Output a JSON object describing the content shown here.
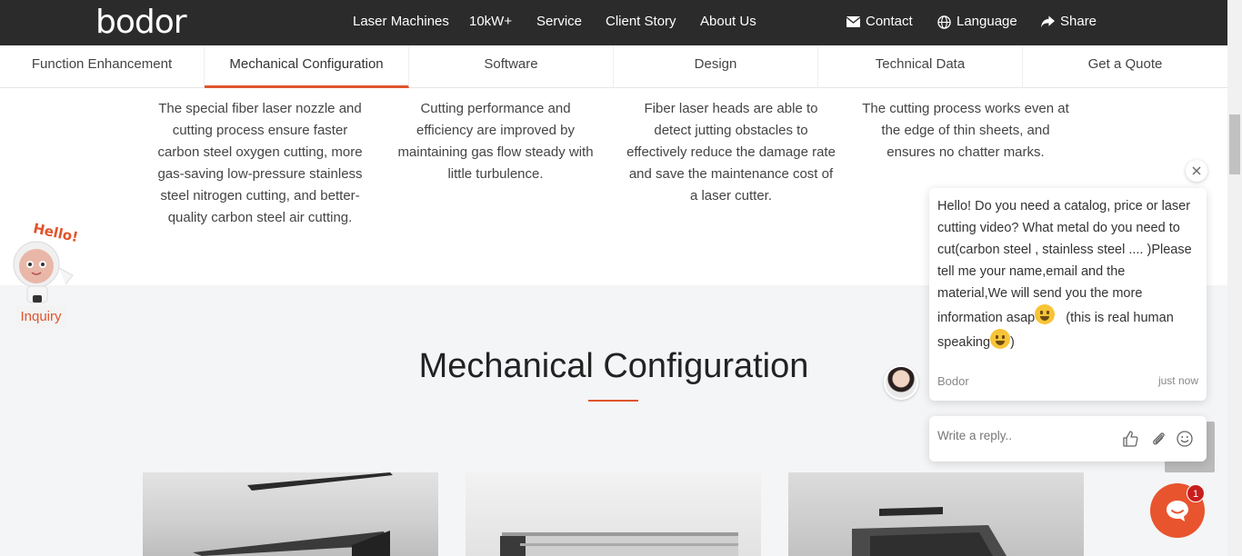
{
  "header": {
    "logo": "bodor",
    "nav": [
      "Laser Machines",
      "10kW+",
      "Service",
      "Client Story",
      "About Us"
    ],
    "contact_label": "Contact",
    "language_label": "Language",
    "share_label": "Share"
  },
  "subtabs": {
    "items": [
      "Function Enhancement",
      "Mechanical Configuration",
      "Software",
      "Design",
      "Technical Data",
      "Get a Quote"
    ],
    "active": "Mechanical Configuration"
  },
  "features": [
    "The special fiber laser nozzle and cutting process ensure faster carbon steel oxygen cutting, more gas-saving low-pressure stainless steel nitrogen cutting, and better-quality carbon steel air cutting.",
    "Cutting performance and efficiency are improved by maintaining gas flow steady with little turbulence.",
    "Fiber laser heads are able to detect jutting obstacles to effectively reduce the damage rate and save the maintenance cost of a laser cutter.",
    "The cutting process works even at the edge of thin sheets, and ensures no chatter marks."
  ],
  "section": {
    "title": "Mechanical Configuration"
  },
  "mascot": {
    "hello_text": "Hello!",
    "inquiry_label": "Inquiry"
  },
  "chat": {
    "message_part1": "Hello! Do you need a catalog, price or laser cutting video? What metal do you need to cut(carbon steel , stainless steel .... )Please tell me your name,email and the material,We will send you the more information asap",
    "message_part2": "(this is real human speaking",
    "message_part3": ")",
    "agent_name": "Bodor",
    "time": "just now",
    "reply_placeholder": "Write a reply..",
    "unread_count": "1"
  },
  "colors": {
    "accent": "#e0542c",
    "nav_bg": "#2b2b2b",
    "section_bg": "#f4f5f7",
    "launcher": "#e8542e"
  }
}
